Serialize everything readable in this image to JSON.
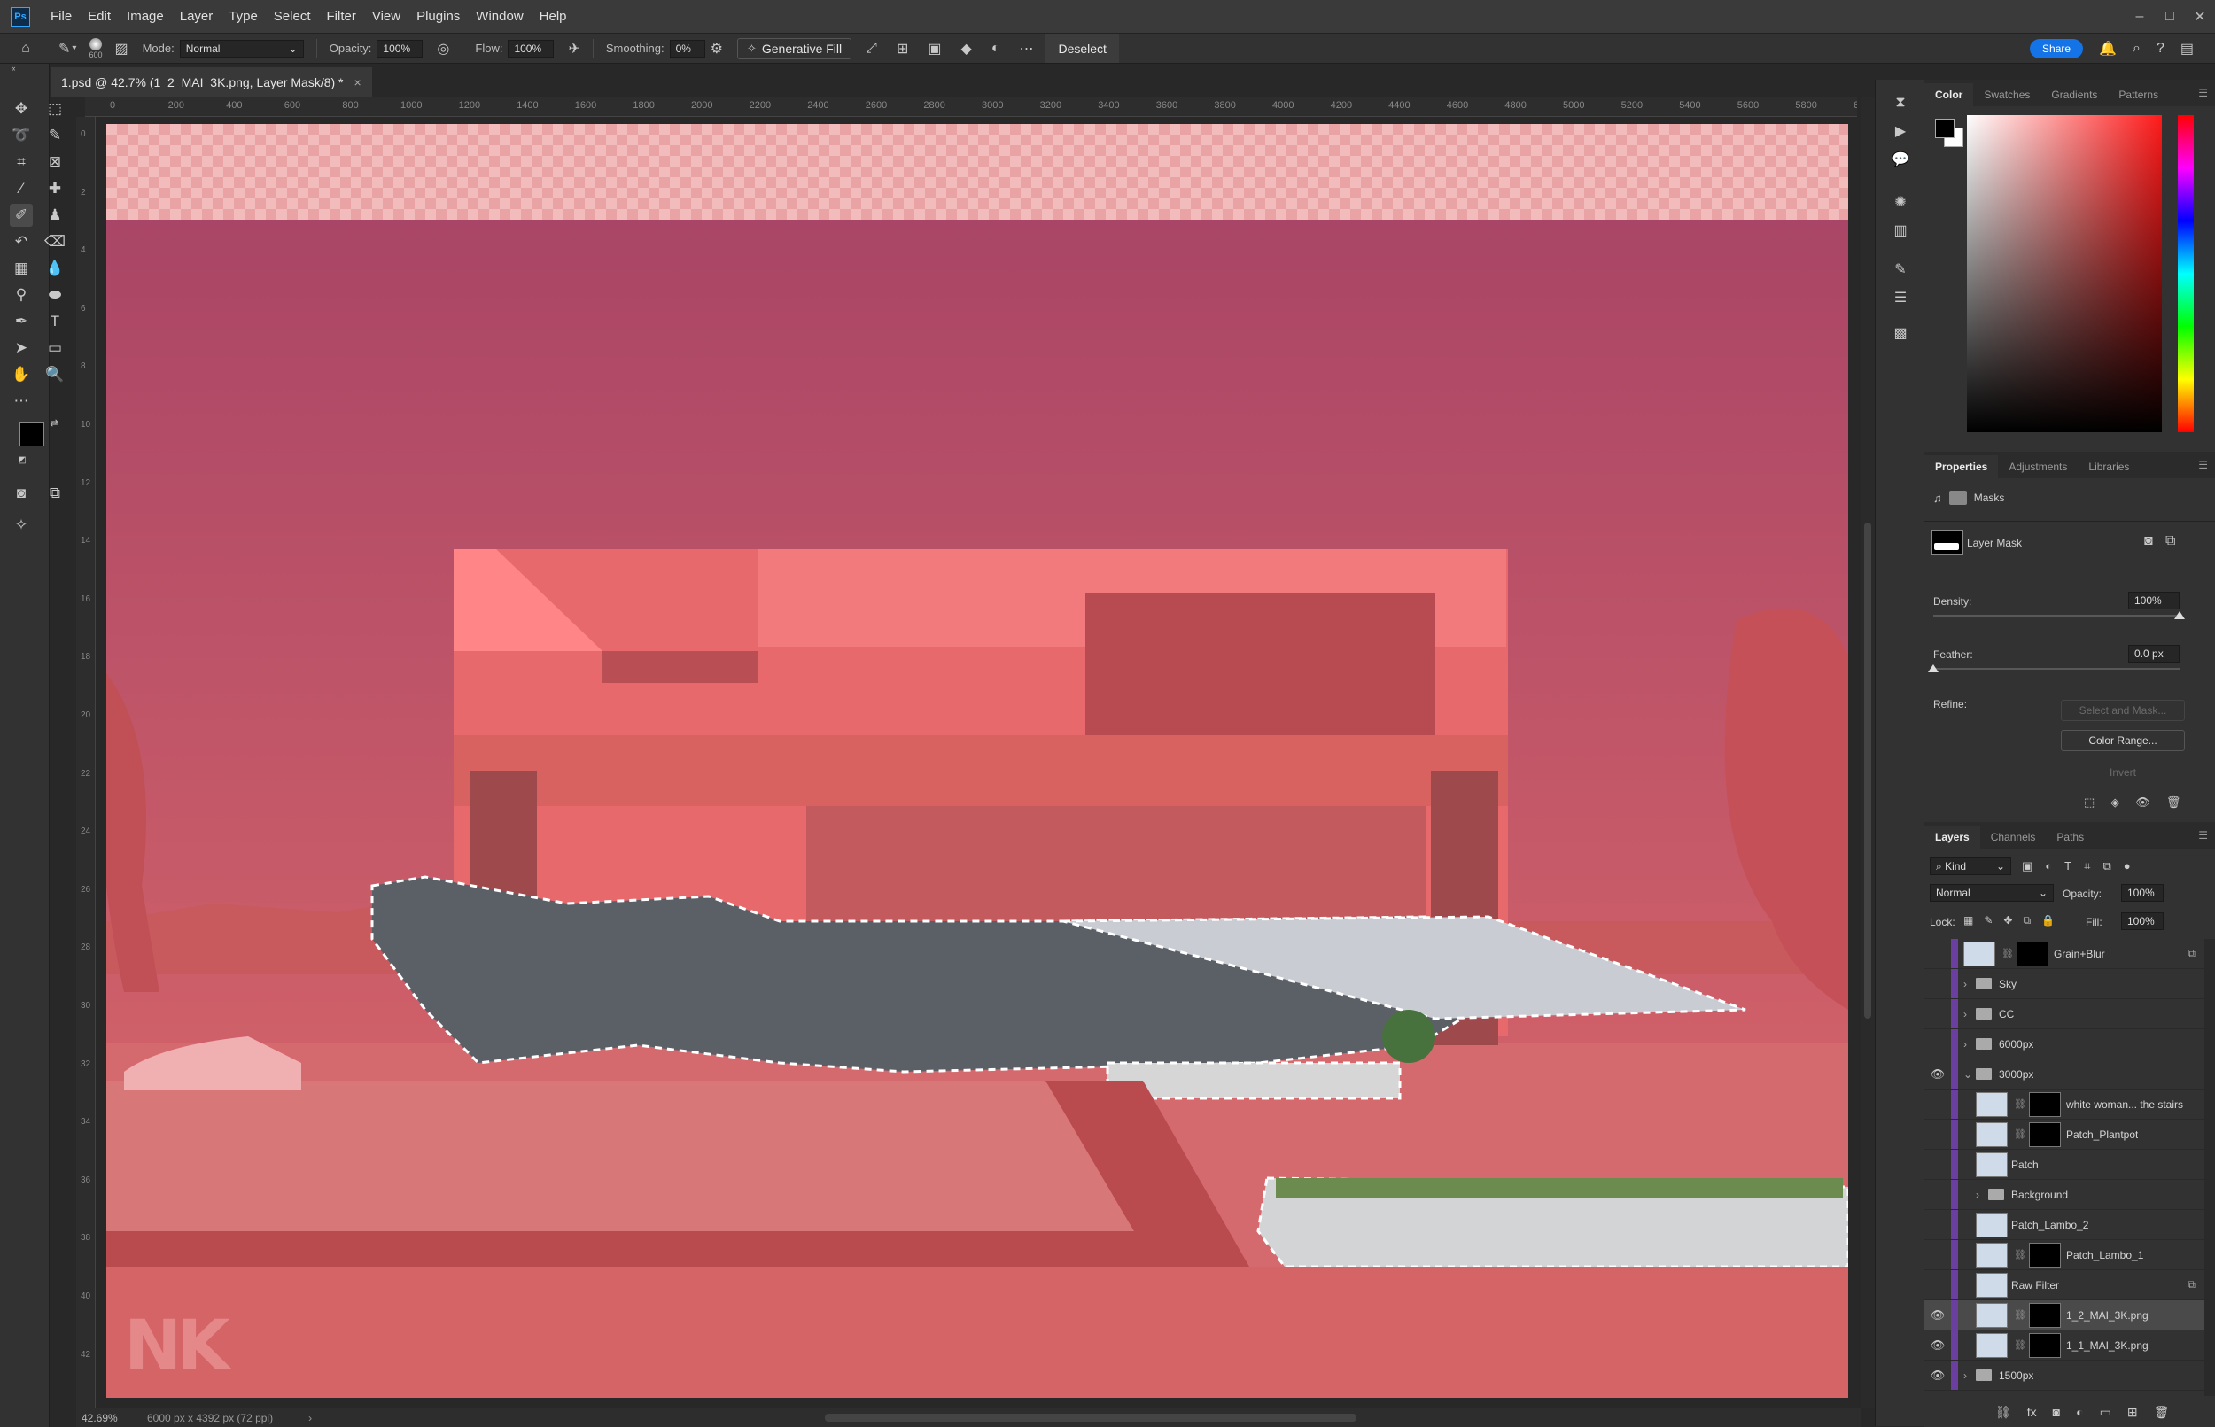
{
  "app": {
    "logo": "Ps"
  },
  "menu": [
    "File",
    "Edit",
    "Image",
    "Layer",
    "Type",
    "Select",
    "Filter",
    "View",
    "Plugins",
    "Window",
    "Help"
  ],
  "window_controls": {
    "minimize": "–",
    "maximize": "□",
    "close": "✕"
  },
  "options": {
    "brush_size": "600",
    "mode_label": "Mode:",
    "mode_value": "Normal",
    "opacity_label": "Opacity:",
    "opacity_value": "100%",
    "flow_label": "Flow:",
    "flow_value": "100%",
    "smoothing_label": "Smoothing:",
    "smoothing_value": "0%",
    "generative_fill": "Generative Fill",
    "deselect": "Deselect",
    "share": "Share"
  },
  "document": {
    "tab_title": "1.psd @ 42.7% (1_2_MAI_3K.png, Layer Mask/8) *",
    "close": "×",
    "zoom": "42.69%",
    "doc_info": "6000 px x 4392 px (72 ppi)"
  },
  "ruler_top": [
    "0",
    "200",
    "400",
    "600",
    "800",
    "1000",
    "1200",
    "1400",
    "1600",
    "1800",
    "2000",
    "2200",
    "2400",
    "2600",
    "2800",
    "3000",
    "3200",
    "3400",
    "3600",
    "3800",
    "4000",
    "4200",
    "4400",
    "4600",
    "4800",
    "5000",
    "5200",
    "5400",
    "5600",
    "5800",
    "60"
  ],
  "ruler_left": [
    "0",
    "2",
    "4",
    "6",
    "8",
    "10",
    "12",
    "14",
    "16",
    "18",
    "20",
    "22",
    "24",
    "26",
    "28",
    "30",
    "32",
    "34",
    "36",
    "38",
    "40",
    "42"
  ],
  "color_panel": {
    "tabs": [
      "Color",
      "Swatches",
      "Gradients",
      "Patterns"
    ],
    "active_tab": "Color",
    "hue_color": "#ff1a1a"
  },
  "properties": {
    "tabs": [
      "Properties",
      "Adjustments",
      "Libraries"
    ],
    "active_tab": "Properties",
    "section": "Masks",
    "layer_mask": "Layer Mask",
    "density_label": "Density:",
    "density_value": "100%",
    "density_level": 1.0,
    "feather_label": "Feather:",
    "feather_value": "0.0 px",
    "feather_level": 0.0,
    "refine_label": "Refine:",
    "select_and_mask": "Select and Mask...",
    "color_range": "Color Range...",
    "invert": "Invert"
  },
  "layers_panel": {
    "tabs": [
      "Layers",
      "Channels",
      "Paths"
    ],
    "active_tab": "Layers",
    "kind_label": "Kind",
    "blend_mode": "Normal",
    "opacity_label": "Opacity:",
    "opacity_value": "100%",
    "lock_label": "Lock:",
    "fill_label": "Fill:",
    "fill_value": "100%",
    "layers": [
      {
        "name": "Grain+Blur",
        "type": "smart",
        "visible": false,
        "mask": true
      },
      {
        "name": "Sky",
        "type": "group",
        "visible": false
      },
      {
        "name": "CC",
        "type": "group",
        "visible": false
      },
      {
        "name": "6000px",
        "type": "group",
        "visible": false
      },
      {
        "name": "3000px",
        "type": "group",
        "visible": true,
        "open": true
      },
      {
        "name": "white woman... the stairs",
        "type": "layer",
        "visible": false,
        "mask": true,
        "indent": 1
      },
      {
        "name": "Patch_Plantpot",
        "type": "layer",
        "visible": false,
        "mask": true,
        "indent": 1
      },
      {
        "name": "Patch",
        "type": "layer",
        "visible": false,
        "indent": 1
      },
      {
        "name": "Background",
        "type": "group",
        "visible": false,
        "indent": 1
      },
      {
        "name": "Patch_Lambo_2",
        "type": "layer",
        "visible": false,
        "indent": 1
      },
      {
        "name": "Patch_Lambo_1",
        "type": "layer",
        "visible": false,
        "mask": true,
        "indent": 1
      },
      {
        "name": "Raw Filter",
        "type": "smart",
        "visible": false,
        "indent": 1
      },
      {
        "name": "1_2_MAI_3K.png",
        "type": "layer",
        "visible": true,
        "mask": true,
        "indent": 1,
        "selected": true
      },
      {
        "name": "1_1_MAI_3K.png",
        "type": "layer",
        "visible": true,
        "mask": true,
        "indent": 1
      },
      {
        "name": "1500px",
        "type": "group",
        "visible": true
      }
    ]
  },
  "watermark": "NK",
  "colors": {
    "mask_overlay": "#d46a6e",
    "accent": "#1473e6",
    "layer_tag": "#6a3fa0"
  }
}
